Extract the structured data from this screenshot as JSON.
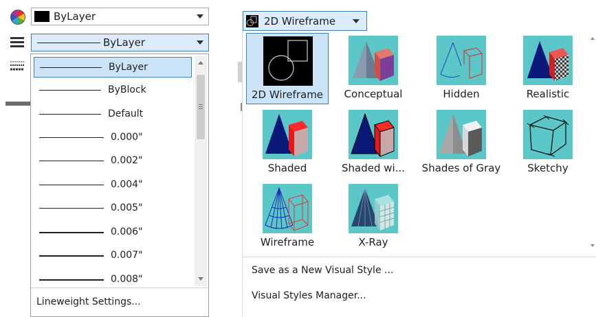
{
  "property_toolbar": {
    "color": {
      "label": "ByLayer",
      "swatch_color": "#000000",
      "icon": "color-wheel-icon"
    },
    "linetype_icon": "lines-icon",
    "lineweight_row_icon": "lineweight-icon",
    "lineweight": {
      "label": "ByLayer",
      "icon": "lineweight-icon"
    }
  },
  "lineweight_dropdown": {
    "items": [
      {
        "label": "ByLayer",
        "selected": true
      },
      {
        "label": "ByBlock"
      },
      {
        "label": "Default"
      },
      {
        "label": "0.000\""
      },
      {
        "label": "0.002\""
      },
      {
        "label": "0.004\""
      },
      {
        "label": "0.005\""
      },
      {
        "label": "0.006\""
      },
      {
        "label": "0.007\""
      },
      {
        "label": "0.008\""
      }
    ],
    "footer": "Lineweight Settings..."
  },
  "visual_styles": {
    "current": "2D Wireframe",
    "styles": [
      {
        "label": "2D Wireframe",
        "icon": "wireframe-2d-thumb",
        "selected": true
      },
      {
        "label": "Conceptual",
        "icon": "conceptual-thumb"
      },
      {
        "label": "Hidden",
        "icon": "hidden-thumb"
      },
      {
        "label": "Realistic",
        "icon": "realistic-thumb"
      },
      {
        "label": "Shaded",
        "icon": "shaded-thumb"
      },
      {
        "label": "Shaded wi...",
        "icon": "shaded-edges-thumb"
      },
      {
        "label": "Shades of Gray",
        "icon": "shades-of-gray-thumb"
      },
      {
        "label": "Sketchy",
        "icon": "sketchy-thumb"
      },
      {
        "label": "Wireframe",
        "icon": "wireframe-thumb"
      },
      {
        "label": "X-Ray",
        "icon": "xray-thumb"
      }
    ],
    "menu": [
      "Save as a New Visual Style ...",
      "Visual Styles Manager..."
    ],
    "accent": "#3c7fb1",
    "thumb_bg": "#5bc7c9"
  }
}
